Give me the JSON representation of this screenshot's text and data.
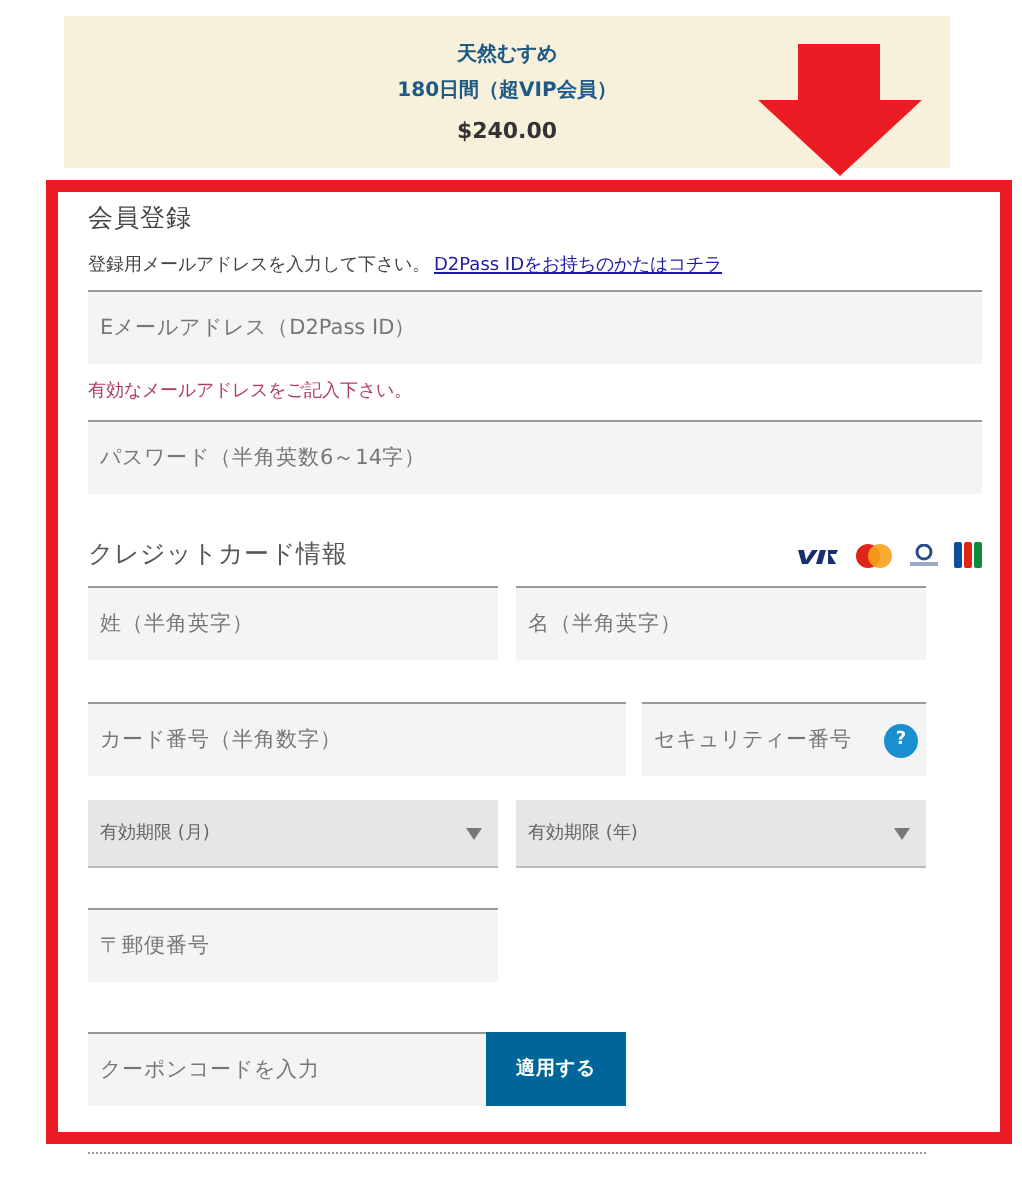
{
  "plan": {
    "name": "天然むすめ",
    "term": "180日間（超VIP会員）",
    "price": "$240.00"
  },
  "registration": {
    "title": "会員登録",
    "instruction": "登録用メールアドレスを入力して下さい。",
    "link": "D2Pass IDをお持ちのかたはコチラ",
    "email_placeholder": "Eメールアドレス（D2Pass ID）",
    "error": "有効なメールアドレスをご記入下さい。",
    "password_placeholder": "パスワード（半角英数6～14字）"
  },
  "card": {
    "title": "クレジットカード情報",
    "last_name_placeholder": "姓（半角英字）",
    "first_name_placeholder": "名（半角英字）",
    "number_placeholder": "カード番号（半角数字）",
    "security_placeholder": "セキュリティー番号",
    "help": "?",
    "month_select": "有効期限 (月)",
    "year_select": "有効期限 (年)",
    "postal_placeholder": "〒郵便番号"
  },
  "coupon": {
    "placeholder": "クーポンコードを入力",
    "button": "適用する"
  }
}
